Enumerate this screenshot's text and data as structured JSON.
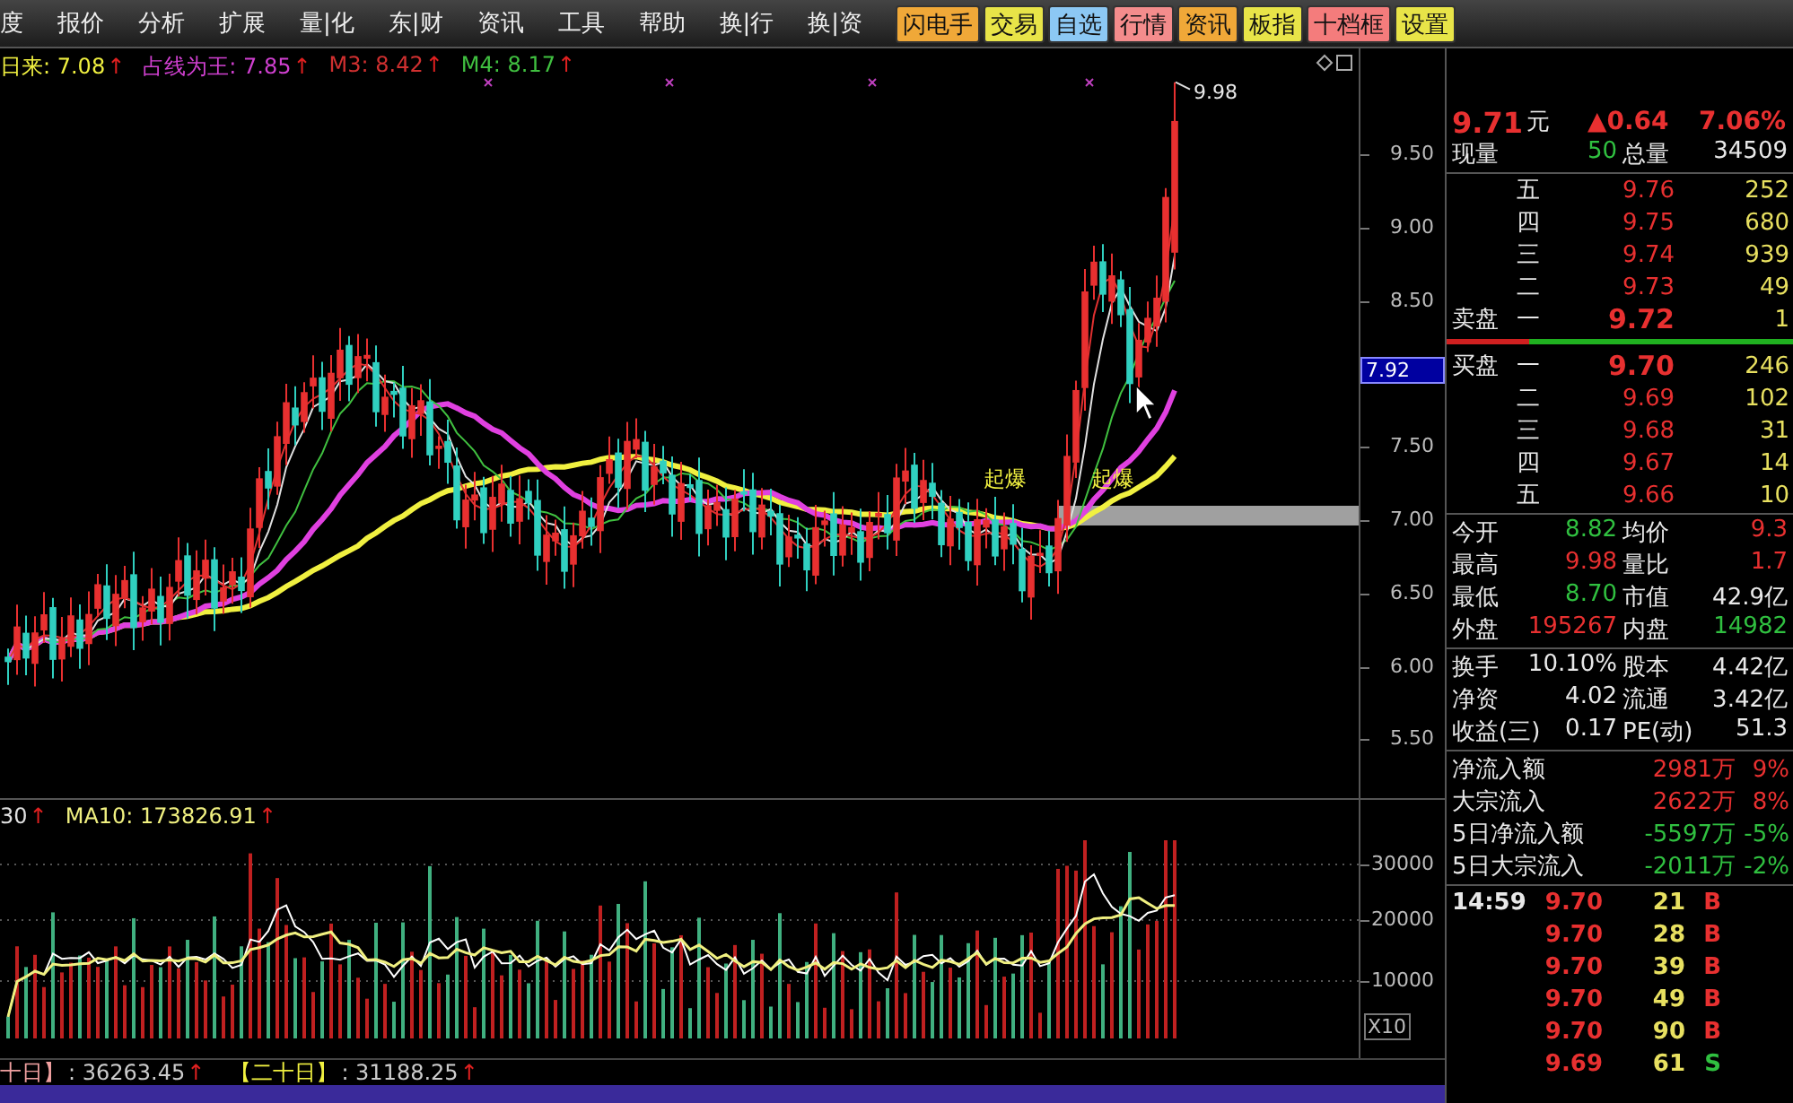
{
  "menu_bar": {
    "items": [
      "度",
      "报价",
      "分析",
      "扩展",
      "量|化",
      "东|财",
      "资讯",
      "工具",
      "帮助",
      "换|行",
      "换|资"
    ],
    "buttons": [
      {
        "label": "闪电手",
        "color": "#f0a838"
      },
      {
        "label": "交易",
        "color": "#e8e448"
      },
      {
        "label": "自选",
        "color": "#8cc8f4"
      },
      {
        "label": "行情",
        "color": "#f48c8c"
      },
      {
        "label": "资讯",
        "color": "#f0a838"
      },
      {
        "label": "板指",
        "color": "#e8e448"
      },
      {
        "label": "十档框",
        "color": "#f47c7c"
      },
      {
        "label": "设置",
        "color": "#e8e448"
      }
    ]
  },
  "price_chart": {
    "legend": [
      {
        "text": "日来: 7.08",
        "arrow": "↑",
        "color": "#f0f040"
      },
      {
        "text": "占线为王: 7.85",
        "arrow": "↑",
        "color": "#d040d0"
      },
      {
        "text": "M3: 8.42",
        "arrow": "↑",
        "color": "#d03030"
      },
      {
        "text": "M4: 8.17",
        "arrow": "↑",
        "color": "#40c040"
      }
    ],
    "axis_labels": [
      "9.50",
      "9.00",
      "8.50",
      "7.50",
      "7.00",
      "6.50",
      "6.00",
      "5.50"
    ],
    "current_price_label": "7.92",
    "high_label": "9.98",
    "signals": [
      "起爆",
      "起爆"
    ]
  },
  "volume_chart": {
    "legend": [
      {
        "text": "30",
        "arrow": "↑",
        "color": "#e0e0e0"
      },
      {
        "text": "MA10: 173826.91",
        "arrow": "↑",
        "color": "#f0f080"
      }
    ],
    "axis_labels": [
      "30000",
      "20000",
      "10000"
    ],
    "scale_label": "X10"
  },
  "bottom_legend": [
    {
      "label": "十日】",
      "value": ": 36263.45",
      "arrow": "↑",
      "color": "#f0a0a0"
    },
    {
      "label": "【二十日】",
      "value": ": 31188.25",
      "arrow": "↑",
      "color": "#f0f040"
    }
  ],
  "quote": {
    "price": "9.71",
    "unit": "元",
    "change": "▲0.64",
    "change_pct": "7.06%",
    "volume_row": [
      {
        "label": "现量",
        "value": "50",
        "color": "#30c040"
      },
      {
        "label": "总量",
        "value": "34509",
        "color": "#e8e8e8"
      }
    ],
    "ask_label": "卖盘",
    "bid_label": "买盘",
    "asks": [
      {
        "level": "五",
        "price": "9.76",
        "size": "252"
      },
      {
        "level": "四",
        "price": "9.75",
        "size": "680"
      },
      {
        "level": "三",
        "price": "9.74",
        "size": "939"
      },
      {
        "level": "二",
        "price": "9.73",
        "size": "49"
      },
      {
        "level": "一",
        "price": "9.72",
        "size": "1"
      }
    ],
    "order_balance": {
      "level": 0.24
    },
    "bids": [
      {
        "level": "一",
        "price": "9.70",
        "size": "246"
      },
      {
        "level": "二",
        "price": "9.69",
        "size": "102"
      },
      {
        "level": "三",
        "price": "9.68",
        "size": "31"
      },
      {
        "level": "四",
        "price": "9.67",
        "size": "14"
      },
      {
        "level": "五",
        "price": "9.66",
        "size": "10"
      }
    ],
    "stats": [
      [
        {
          "label": "今开",
          "value": "8.82",
          "color": "#30c040"
        },
        {
          "label": "均价",
          "value": "9.3",
          "color": "#e83030"
        }
      ],
      [
        {
          "label": "最高",
          "value": "9.98",
          "color": "#e83030"
        },
        {
          "label": "量比",
          "value": "1.7",
          "color": "#e83030"
        }
      ],
      [
        {
          "label": "最低",
          "value": "8.70",
          "color": "#30c040"
        },
        {
          "label": "市值",
          "value": "42.9亿",
          "color": "#e8e8e8"
        }
      ],
      [
        {
          "label": "外盘",
          "value": "195267",
          "color": "#e83030"
        },
        {
          "label": "内盘",
          "value": "14982",
          "color": "#30c040"
        }
      ]
    ],
    "fundamentals": [
      [
        {
          "label": "换手",
          "value": "10.10%"
        },
        {
          "label": "股本",
          "value": "4.42亿"
        }
      ],
      [
        {
          "label": "净资",
          "value": "4.02"
        },
        {
          "label": "流通",
          "value": "3.42亿"
        }
      ],
      [
        {
          "label": "收益(三)",
          "value": "0.17"
        },
        {
          "label": "PE(动)",
          "value": "51.3"
        }
      ]
    ],
    "flows": [
      {
        "label": "净流入额",
        "amount": "2981万",
        "pct": "9%",
        "color": "#e83030"
      },
      {
        "label": "大宗流入",
        "amount": "2622万",
        "pct": "8%",
        "color": "#e83030"
      },
      {
        "label": "5日净流入额",
        "amount": "-5597万",
        "pct": "-5%",
        "color": "#30c040"
      },
      {
        "label": "5日大宗流入",
        "amount": "-2011万",
        "pct": "-2%",
        "color": "#30c040"
      }
    ],
    "ticks": [
      {
        "time": "14:59",
        "price": "9.70",
        "size": "21",
        "side": "B",
        "kind": "buy"
      },
      {
        "price": "9.70",
        "size": "28",
        "side": "B",
        "kind": "buy"
      },
      {
        "price": "9.70",
        "size": "39",
        "side": "B",
        "kind": "buy"
      },
      {
        "price": "9.70",
        "size": "49",
        "side": "B",
        "kind": "buy"
      },
      {
        "price": "9.70",
        "size": "90",
        "side": "B",
        "kind": "buy"
      },
      {
        "price": "9.69",
        "size": "61",
        "side": "S",
        "kind": "sell"
      }
    ]
  }
}
